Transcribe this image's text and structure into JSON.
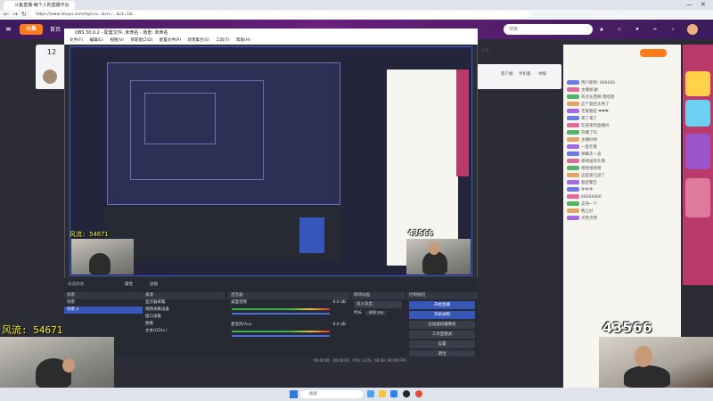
{
  "browser": {
    "tab_title": "斗鱼直播·每个人的直播平台",
    "url": "https://www.douyu.com/topic/s...&ch=...&ct=1&..."
  },
  "site": {
    "logo": "斗鱼",
    "home": "首页",
    "search_placeholder": "搜索",
    "header_icons": [
      "live-icon",
      "history-icon",
      "follow-icon",
      "message-icon",
      "download-icon",
      "avatar"
    ]
  },
  "page": {
    "left_number": "12",
    "stream_actions": [
      "分享",
      "客户端",
      "手机看",
      "举报"
    ]
  },
  "obs": {
    "title": "OBS 30.0.2 - 配置文件: 未命名 - 场景: 未命名",
    "menu": [
      "文件(F)",
      "编辑(E)",
      "视图(V)",
      "停靠窗口(D)",
      "配置文件(P)",
      "场景集合(S)",
      "工具(T)",
      "帮助(H)"
    ],
    "scenes_header": "场景",
    "scenes": [
      "场景",
      "场景 2"
    ],
    "sources_header": "来源",
    "sources": [
      "显示器采集",
      "视频采集设备",
      "窗口采集",
      "图像",
      "文本(GDI+)"
    ],
    "mixer_header": "混音器",
    "mixer": [
      {
        "name": "桌面音频",
        "db": "0.0 dB"
      },
      {
        "name": "麦克风/Aux",
        "db": "0.0 dB"
      }
    ],
    "transitions_header": "转场动画",
    "transition": "淡入淡出",
    "duration_label": "时长",
    "duration": "300 ms",
    "controls_header": "控制按钮",
    "controls": [
      "开始直播",
      "开始录制",
      "启动虚拟摄像机",
      "工作室模式",
      "设置",
      "退出"
    ],
    "no_source": "未选择源",
    "properties_label": "属性",
    "filters_label": "滤镜",
    "status": [
      "00:00:00",
      "00:00:00",
      "CPU: 3.2%",
      "60.00 / 60.00 FPS"
    ]
  },
  "overlay": {
    "left_counter_label": "风流:",
    "left_counter_value": "54671",
    "right_counter_value": "43566",
    "inner_left_counter": "风流: 54671",
    "inner_right_counter": "43566"
  },
  "chat": {
    "lines": [
      "用户昵称: 666666",
      "主播加油!",
      "有点东西啊 哈哈哈",
      "这个套娃太秀了",
      "无限套娃 ❤❤❤",
      "来了来了",
      "欢迎来到直播间",
      "开播了吗",
      "主播好帅",
      "一直在看",
      "弹幕走一波",
      "感谢送的礼物",
      "哈哈哈哈哈",
      "这是第几层了",
      "套娃警告",
      "牛牛牛",
      "66666666",
      "支持一下",
      "晚上好",
      "点赞点赞"
    ]
  },
  "taskbar": {
    "search": "搜索"
  },
  "colors": {
    "accent": "#ff7a1a",
    "obs_blue": "#3656b8",
    "counter_yellow": "#f5ef23"
  }
}
